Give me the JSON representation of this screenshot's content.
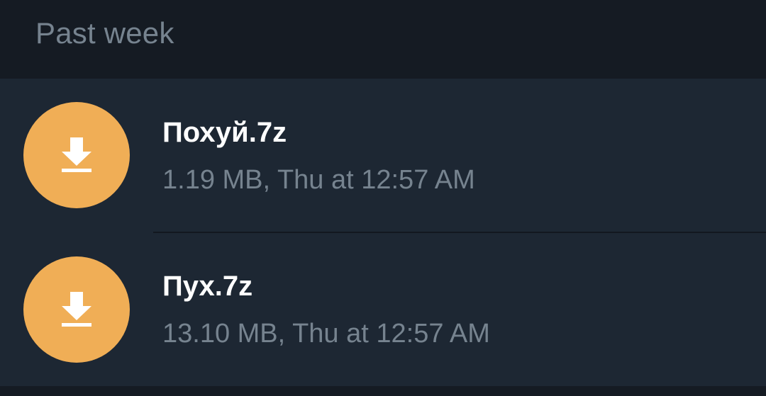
{
  "section": {
    "title": "Past week"
  },
  "files": [
    {
      "name": "Похуй.7z",
      "meta": "1.19 MB, Thu at 12:57 AM",
      "icon": "download-icon"
    },
    {
      "name": "Пух.7z",
      "meta": "13.10 MB, Thu at 12:57 AM",
      "icon": "download-icon"
    }
  ],
  "colors": {
    "header_bg": "#151b23",
    "list_bg": "#1d2733",
    "icon_bg": "#f0ae56",
    "title_text": "#ffffff",
    "secondary_text": "#76838f"
  }
}
